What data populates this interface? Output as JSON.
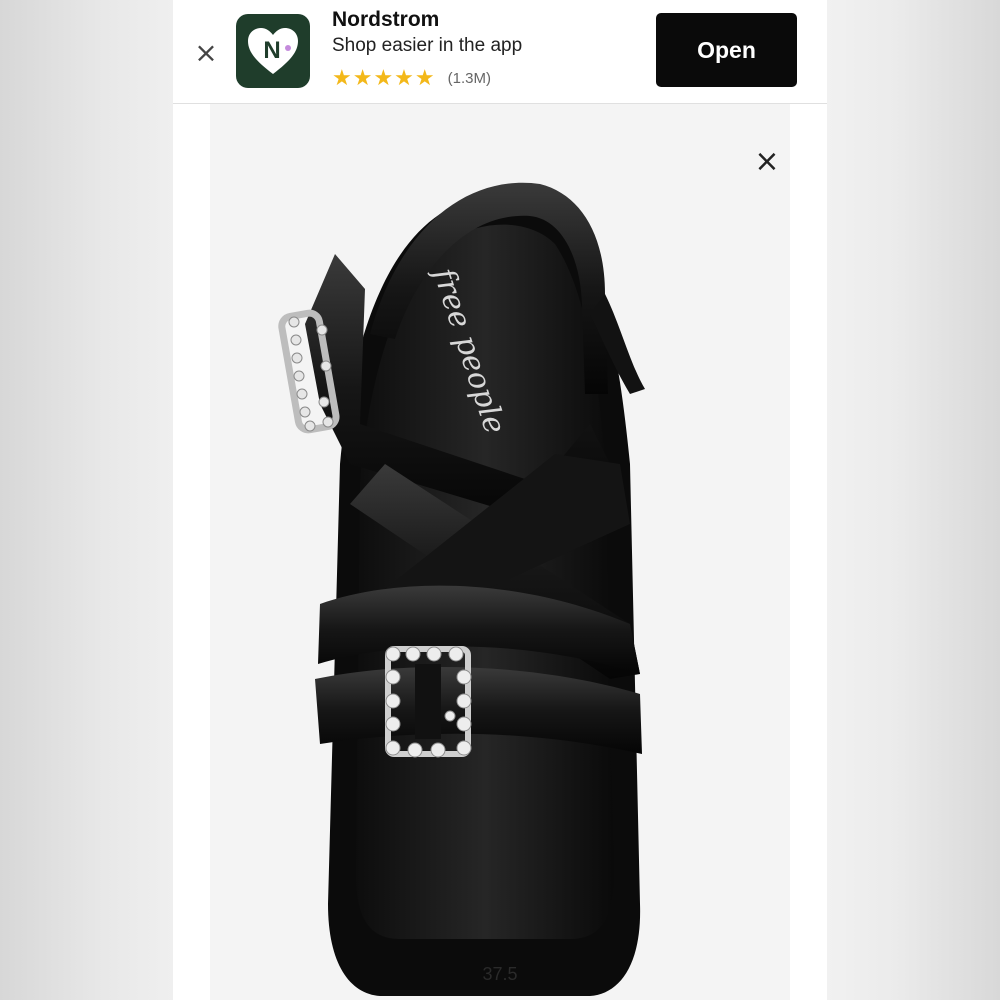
{
  "banner": {
    "close_icon": "×",
    "app_name": "Nordstrom",
    "tagline": "Shop easier in the app",
    "stars": "★★★★★",
    "rating_count": "(1.3M)",
    "open_label": "Open",
    "icon_letter": "N"
  },
  "product": {
    "close_icon": "×",
    "insole_brand": "free people",
    "size_mark": "37.5"
  },
  "colors": {
    "star": "#f3b81a",
    "app_icon_bg": "#1f3d2b",
    "open_button_bg": "#0a0a0a"
  }
}
